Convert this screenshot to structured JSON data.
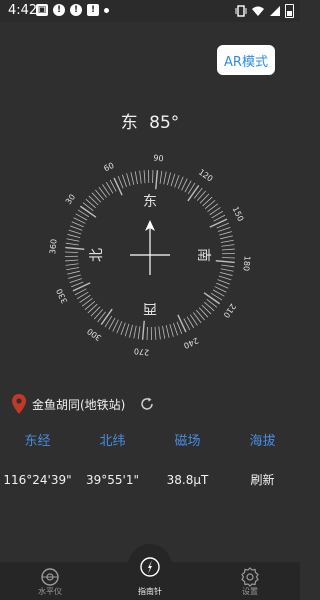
{
  "status_bar": {
    "time": "4:42",
    "left_icons": [
      "image-icon",
      "alert-icon",
      "alert-icon",
      "notification-icon",
      "dot-icon"
    ],
    "right_icons": [
      "vibrate-icon",
      "wifi-icon",
      "signal-icon",
      "battery-icon"
    ]
  },
  "ar_button": {
    "label": "AR模式"
  },
  "heading": {
    "direction": "东",
    "degrees": "85°"
  },
  "compass": {
    "heading_deg": 85,
    "degree_labels": [
      "90",
      "120",
      "150",
      "180",
      "210",
      "240",
      "270",
      "300",
      "330",
      "360",
      "30",
      "60"
    ],
    "cardinal_labels": {
      "top": "东",
      "right": "南",
      "bottom": "西",
      "left": "北"
    },
    "colors": {
      "ticks": "#bdbdbd",
      "text": "#e0e0e0",
      "center": "#ffffff"
    }
  },
  "location": {
    "name": "金鱼胡同(地铁站)",
    "pin_color": "#c0392b"
  },
  "info": {
    "labels": [
      "东经",
      "北纬",
      "磁场",
      "海拔"
    ],
    "values": [
      "116°24'39\"",
      "39°55'1\"",
      "38.8μT",
      "刷新"
    ]
  },
  "nav": {
    "items": [
      {
        "label": "水平仪",
        "icon": "level-icon"
      },
      {
        "label": "指南针",
        "icon": "compass-icon"
      },
      {
        "label": "设置",
        "icon": "settings-gear-icon"
      }
    ]
  }
}
